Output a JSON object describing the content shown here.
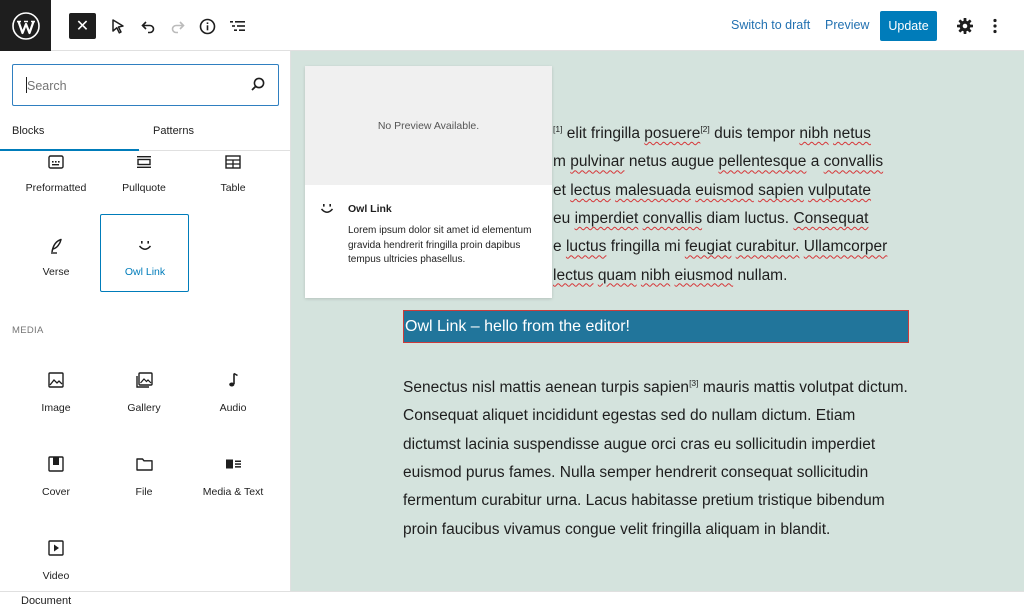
{
  "toolbar": {
    "close_label": "✕",
    "switch_to_draft": "Switch to draft",
    "preview": "Preview",
    "update": "Update"
  },
  "inserter": {
    "search_placeholder": "Search",
    "tabs": [
      "Blocks",
      "Patterns"
    ],
    "text_blocks": [
      {
        "label": "Preformatted",
        "icon": "preformatted-icon"
      },
      {
        "label": "Pullquote",
        "icon": "pullquote-icon"
      },
      {
        "label": "Table",
        "icon": "table-icon"
      },
      {
        "label": "Verse",
        "icon": "verse-icon"
      },
      {
        "label": "Owl Link",
        "icon": "owl-link-icon",
        "selected": true
      }
    ],
    "media_section_label": "MEDIA",
    "media_blocks": [
      {
        "label": "Image",
        "icon": "image-icon"
      },
      {
        "label": "Gallery",
        "icon": "gallery-icon"
      },
      {
        "label": "Audio",
        "icon": "audio-icon"
      },
      {
        "label": "Cover",
        "icon": "cover-icon"
      },
      {
        "label": "File",
        "icon": "file-icon"
      },
      {
        "label": "Media & Text",
        "icon": "media-text-icon"
      },
      {
        "label": "Video",
        "icon": "video-icon"
      }
    ]
  },
  "preview_popover": {
    "no_preview": "No Preview Available.",
    "title": "Owl Link",
    "description": "Lorem ipsum dolor sit amet id elementum gravida hendrerit fringilla proin dapibus tempus ultricies phasellus."
  },
  "content": {
    "paragraph1_lines": [
      {
        "sup": "[1]",
        "pre": " elit fringilla ",
        "w1": "posuere",
        "sup2": "[2]",
        "post": " duis tempor ",
        "w2": "nibh",
        "w3": "netus"
      },
      "m pulvinar netus augue pellentesque a convallis",
      "et lectus malesuada euismod sapien vulputate",
      "eu imperdiet convallis diam luctus. Consequat",
      "e luctus fringilla mi feugiat curabitur. Ullamcorper",
      "lectus quam nibh eiusmod nullam."
    ],
    "owl_link_text": "Owl Link – hello from the editor!",
    "paragraph2": {
      "pre": "Senectus nisl mattis aenean turpis sapien",
      "sup": "[3]",
      "post": " mauris mattis volutpat dictum. Consequat aliquet incididunt egestas sed do nullam dictum. Etiam dictumst lacinia suspendisse augue orci cras eu sollicitudin imperdiet euismod purus fames. Nulla semper hendrerit consequat sollicitudin fermentum curabitur urna. Lacus habitasse pretium tristique bibendum proin faucibus vivamus congue velit fringilla aliquam in blandit."
    }
  },
  "footer": {
    "breadcrumb": "Document"
  }
}
